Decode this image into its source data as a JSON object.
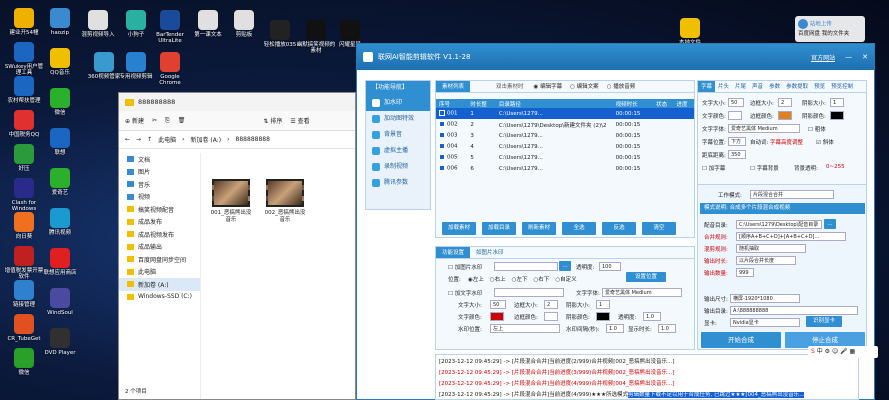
{
  "desktop": {
    "icons_left": [
      {
        "label": "建业开54幢",
        "color": "#f0b000"
      },
      {
        "label": "SWukey用户管理工具",
        "color": "#1a66c0"
      },
      {
        "label": "农村帮扶管理",
        "color": "#1a66c0"
      },
      {
        "label": "中国税务QQ",
        "color": "#e03030"
      },
      {
        "label": "好压",
        "color": "#2a9a3a"
      },
      {
        "label": "Clash for Windows",
        "color": "#2a2a8a"
      },
      {
        "label": "向日葵",
        "color": "#f07020"
      },
      {
        "label": "增值税发票开票软件",
        "color": "#c02020"
      },
      {
        "label": "链接管理",
        "color": "#3080d0"
      },
      {
        "label": "CR_TubeGet",
        "color": "#e05020"
      },
      {
        "label": "微信",
        "color": "#2aa02a"
      }
    ],
    "icons_col2": [
      {
        "label": "haozip",
        "color": "#3a8ad0"
      },
      {
        "label": "QQ音乐",
        "color": "#f0c000"
      },
      {
        "label": "微信",
        "color": "#2ab02a"
      },
      {
        "label": "联想",
        "color": "#1a66c0"
      },
      {
        "label": "爱奇艺",
        "color": "#2ab02a"
      },
      {
        "label": "腾讯视频",
        "color": "#1a9ad0"
      },
      {
        "label": "联想应用商店",
        "color": "#e02020"
      },
      {
        "label": "WindSoul",
        "color": "#4a4aa0"
      },
      {
        "label": "DVD Player",
        "color": "#303030"
      }
    ],
    "icons_top": [
      {
        "label": "混剪视频导入",
        "color": "#e0e0e0"
      },
      {
        "label": "小狗子",
        "color": "#2ab0a0"
      },
      {
        "label": "BarTender UltraLite",
        "color": "#1a4a9a"
      },
      {
        "label": "第一课文本",
        "color": "#e0e0e0"
      },
      {
        "label": "剪贴板",
        "color": "#e0e0e0"
      },
      {
        "label": "轻松播放035",
        "color": "#222"
      },
      {
        "label": "幽默搞笑视频的素材",
        "color": "#111"
      },
      {
        "label": "闪耀星星",
        "color": "#111"
      },
      {
        "label": "Google Chrome",
        "color": "#e04030"
      },
      {
        "label": "专用视频剪辑",
        "color": "#2a80d0"
      },
      {
        "label": "360视频管家",
        "color": "#3a9ad0"
      }
    ],
    "icons_right": [
      {
        "label": "本地文件",
        "color": "#f0c000"
      },
      {
        "label": "Microsoft Edge",
        "color": "#1a8ad0"
      },
      {
        "label": "1",
        "color": "#f0c000"
      }
    ],
    "baidu_label": "百度网盘",
    "upload_label": "站地上传",
    "baidu_sub": "我的文件夹",
    "tray_label": "中"
  },
  "explorer": {
    "title": "888888888",
    "new_btn": "新建",
    "sort_btn": "排序",
    "view_btn": "查看",
    "breadcrumb": [
      "此电脑",
      "新加卷 (A:)",
      "888888888"
    ],
    "nav_items": [
      {
        "label": "文档"
      },
      {
        "label": "图片"
      },
      {
        "label": "音乐"
      },
      {
        "label": "视频"
      },
      {
        "label": "搞笑视频配音"
      },
      {
        "label": "成品发布"
      },
      {
        "label": "成品视频发布"
      },
      {
        "label": "成品输出"
      },
      {
        "label": "百度网盘同步空间"
      },
      {
        "label": "此电脑"
      },
      {
        "label": "新加卷 (A:)"
      },
      {
        "label": "Windows-SSD (C:)"
      }
    ],
    "files": [
      {
        "name": "001_恶搞熊出没音乐"
      },
      {
        "name": "002_恶搞熊出没音乐"
      }
    ],
    "status": "2 个项目"
  },
  "app": {
    "title": "联网AI智能剪辑软件 V1.1-28",
    "website": "官方网站",
    "sidebar": {
      "header": "【功能导航】",
      "items": [
        "加水印",
        "加动图特效",
        "背景音",
        "虚拟主播",
        "录制视频",
        "腾讯参数"
      ]
    },
    "material": {
      "tab": "素材列表",
      "mode_label": "双击素材时",
      "radio_options": [
        "编辑字幕",
        "编辑文案",
        "播放音频"
      ],
      "columns": [
        "序号",
        "时长整",
        "目录路径",
        "视频时长",
        "状态",
        "进度"
      ],
      "rows": [
        {
          "id": "001",
          "count": "1",
          "path": "C:\\Users\\1279...",
          "dur": "00:00:15"
        },
        {
          "id": "002",
          "count": "2",
          "path": "C:\\Users\\1279\\Desktop\\新建文件夹 (2)\\2",
          "dur": "00:00:15"
        },
        {
          "id": "003",
          "count": "3",
          "path": "C:\\Users\\1279...",
          "dur": "00:00:15"
        },
        {
          "id": "004",
          "count": "4",
          "path": "C:\\Users\\1279...",
          "dur": "00:00:15"
        },
        {
          "id": "005",
          "count": "5",
          "path": "C:\\Users\\1279...",
          "dur": "00:00:15"
        },
        {
          "id": "006",
          "count": "6",
          "path": "C:\\Users\\1279...",
          "dur": "00:00:15"
        }
      ],
      "buttons": [
        "加载素材",
        "加载目录",
        "刷新素材",
        "全选",
        "反选",
        "清空"
      ]
    },
    "watermark": {
      "tabs": [
        "功能设置",
        "如图片水印"
      ],
      "img_wm_label": "加图片水印",
      "opacity_label": "透明度:",
      "opacity": "100",
      "position_label": "位置:",
      "positions": [
        "左上",
        "右上",
        "左下",
        "右下",
        "自定义"
      ],
      "set_position": "设置位置",
      "text_wm_label": "加文字水印",
      "text_font_label": "文字字体:",
      "text_font": "爱奇艺黑体 Medium",
      "text_size_label": "文字大小:",
      "text_size": "50",
      "border_label": "边框大小:",
      "border": "2",
      "shadow_label": "阴影大小:",
      "shadow": "1",
      "text_color_label": "文字颜色:",
      "border_color_label": "边框颜色:",
      "shadow_color_label": "阴影颜色:",
      "opacity2_label": "透明度:",
      "opacity_val": "1.0",
      "wm_pos_label": "水印位置:",
      "wm_pos": "左上",
      "wm_interval_label": "水印间隔(秒):",
      "wm_interval": "1.0",
      "wm_duration_label": "显示时长:",
      "wm_duration": "1.0"
    },
    "subtitle": {
      "tabs": [
        "字幕",
        "片头",
        "片尾",
        "声音",
        "参数",
        "参数提取",
        "预览",
        "预览控制"
      ],
      "font_size_label": "文字大小:",
      "font_size": "50",
      "border_size_label": "边框大小:",
      "border_size": "2",
      "shadow_size_label": "阴影大小:",
      "shadow_size": "1",
      "text_color_label": "文字颜色:",
      "border_color_label": "边框颜色:",
      "shadow_color_label": "阴影颜色:",
      "font_label": "文字字体:",
      "font": "爱奇艺黑体 Medium",
      "bold": "粗体",
      "pos_label": "字幕位置:",
      "pos": "下方",
      "sub_label": "自动词:",
      "sub_val": "字幕高度调整",
      "italic": "斜体",
      "distance_label": "距底距离:",
      "distance": "350",
      "check_add": "加字幕",
      "check_sub": "字幕背景",
      "bg_trans_label": "背景透明:",
      "bg_trans": "0~255"
    },
    "work": {
      "mode_label": "工作模式:",
      "mode": "片段混合合并",
      "mode_hint": "模式说明: 合成多个片段混合成视频",
      "config_dir_label": "配音目录:",
      "config_dir": "C:\\Users\\1279\\Desktop\\配音目录",
      "merge_rule_label": "合并规则:",
      "merge_rule": "[顺序A+B+C+D]+[A+B+C+D]...",
      "mix_rule_label": "混剪规则:",
      "mix_rule": "随机抽取",
      "output_label": "输出时长:",
      "output": "以片段合并长度",
      "count_label": "输出数量:",
      "count": "999",
      "res_label": "输出尺寸:",
      "res": "横屏-1920*1080",
      "out_dir_label": "输出目录:",
      "out_dir": "A:\\888888888",
      "gpu_label": "显卡:",
      "gpu": "Nvidia显卡",
      "gpu_btn": "识别显卡",
      "start_btn": "开始合成",
      "stop_btn": "停止合成"
    },
    "logs": [
      "[2023-12-12 09:45:29] -> [片段混合合并]当前进度(2/999)合并视频[002_恶搞熊出没音乐...]",
      "[2023-12-12 09:45:29] -> [片段混合合并]当前进度(3/999)合并视频[002_恶搞熊出没音乐...]",
      "[2023-12-12 09:45:29] -> [片段混合合并]当前进度(4/999)合并视频[004_恶搞熊出没音乐...]",
      "[2023-12-12 09:45:29] -> [片段混合合并]当前进度(4/999)★★★所选模式",
      "[2023-12-12 09:45:30] -> 全部任务已完成"
    ],
    "log_highlight": "剪辑数量下载不足以用于合成任务, 已跳过★★★[004_恶搞熊出没音乐..."
  },
  "colors": {
    "accent": "#2f8fd0",
    "selection": "#1560d0",
    "desktop_bg": "#0b1a3c"
  }
}
